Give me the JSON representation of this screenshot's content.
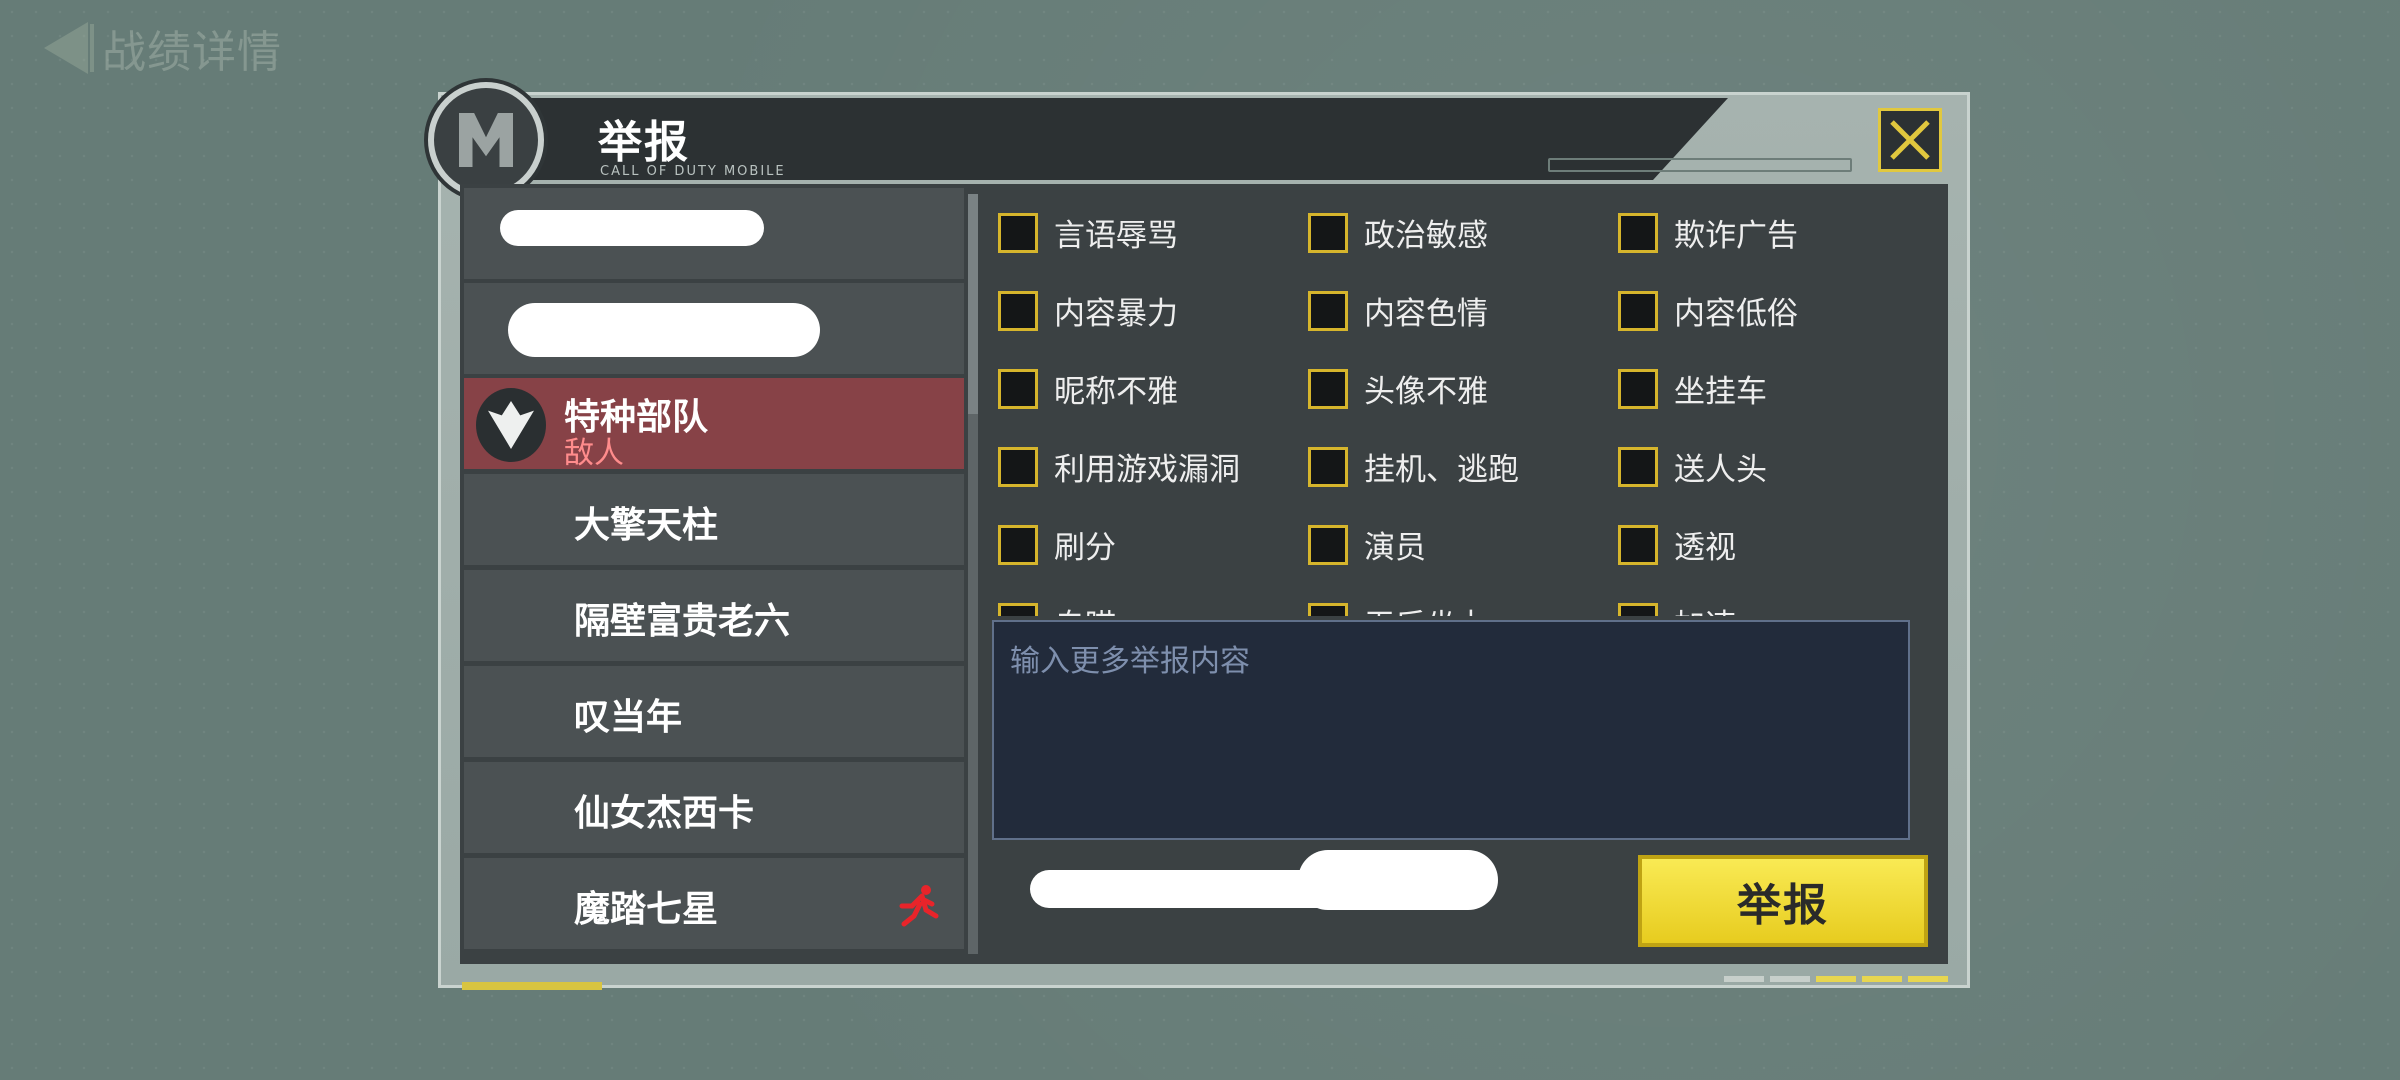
{
  "nav": {
    "back_label": "战绩详情"
  },
  "dialog": {
    "title": "举报",
    "subtitle": "CALL OF DUTY MOBILE"
  },
  "players": [
    {
      "name": "",
      "redacted": true
    },
    {
      "name": "",
      "redacted": true
    },
    {
      "name": "特种部队",
      "status": "敌人",
      "selected": true,
      "icon": "faction-emblem-icon"
    },
    {
      "name": "大擎天柱"
    },
    {
      "name": "隔壁富贵老六"
    },
    {
      "name": "叹当年"
    },
    {
      "name": "仙女杰西卡"
    },
    {
      "name": "魔踏七星",
      "status_icon": "runner-icon",
      "status_icon_color": "#e8242a"
    }
  ],
  "reasons": {
    "rows": [
      [
        "言语辱骂",
        "政治敏感",
        "欺诈广告"
      ],
      [
        "内容暴力",
        "内容色情",
        "内容低俗"
      ],
      [
        "昵称不雅",
        "头像不雅",
        "坐挂车"
      ],
      [
        "利用游戏漏洞",
        "挂机、逃跑",
        "送人头"
      ],
      [
        "刷分",
        "演员",
        "透视"
      ],
      [
        "自瞄",
        "无后坐力",
        "加速"
      ]
    ]
  },
  "input": {
    "placeholder": "输入更多举报内容",
    "value": ""
  },
  "submit_label": "举报",
  "colors": {
    "accent_yellow": "#e7cc1f",
    "checkbox_border": "#d6b52c",
    "selected_row": "#874247",
    "enemy_text": "#ff8c8c",
    "background": "#667c77"
  }
}
